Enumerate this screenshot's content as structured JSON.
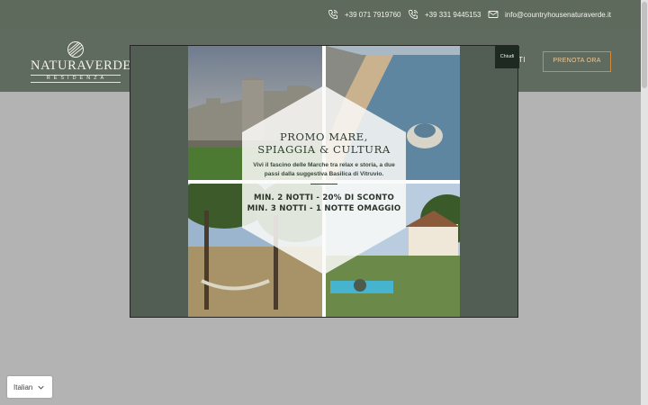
{
  "topbar": {
    "phone1": "+39 071 7919760",
    "phone2": "+39 331 9445153",
    "email": "info@countryhousenaturaverde.it"
  },
  "logo": {
    "name": "NATURAVERDE",
    "subtitle": "RESIDENZA"
  },
  "nav": {
    "partial_item": "TI"
  },
  "header": {
    "cta_label": "PRENOTA ORA"
  },
  "modal": {
    "close_label": "Chiudi",
    "promo": {
      "title_line1": "PROMO MARE,",
      "title_line2": "SPIAGGIA & CULTURA",
      "description": "Vivi il fascino delle Marche tra relax e storia, a due passi dalla suggestiva Basilica di Vitruvio.",
      "offer_line1": "MIN. 2 NOTTI - 20% DI SCONTO",
      "offer_line2": "MIN. 3 NOTTI - 1 NOTTE OMAGGIO"
    }
  },
  "language_selector": {
    "value": "Italian"
  },
  "colors": {
    "header_bg": "#5f6b5e",
    "overlay": "#b3b3b3",
    "accent": "#d08b3e",
    "modal_bg": "#525e53"
  },
  "icons": [
    "phone-icon",
    "phone-icon",
    "mail-icon",
    "chevron-down-icon",
    "logo-leaf-icon"
  ]
}
